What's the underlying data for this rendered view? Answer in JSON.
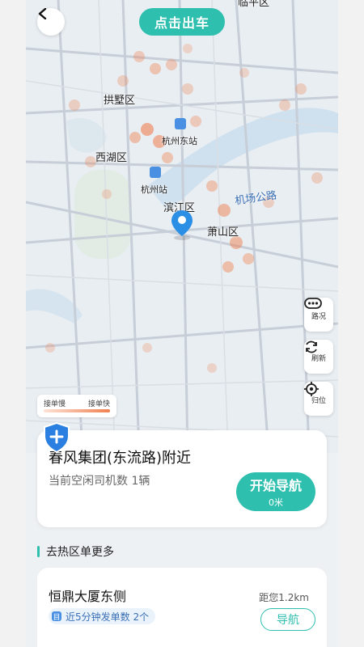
{
  "header": {
    "depart_label": "点击出车"
  },
  "map": {
    "district_labels": [
      "拱墅区",
      "西湖区",
      "滨江区",
      "萧山区",
      "临平区"
    ],
    "station_labels": [
      "杭州东站",
      "杭州站"
    ],
    "road_labels": [
      "机场公路"
    ]
  },
  "controls": {
    "traffic_label": "路况",
    "refresh_label": "刷新",
    "locate_label": "归位"
  },
  "legend": {
    "slow_label": "接单慢",
    "fast_label": "接单快",
    "gradient_start": "#fde3d6",
    "gradient_end": "#f08050"
  },
  "location_card": {
    "title": "春风集团(东流路)附近",
    "idle_drivers": "当前空闲司机数 1辆",
    "nav_button_label": "开始导航",
    "nav_distance": "0米"
  },
  "hot_section": {
    "title": "去热区单更多",
    "items": [
      {
        "name": "恒鼎大厦东侧",
        "distance": "距您1.2km",
        "tag_icon": "目",
        "tag_text": "近5分钟发单数 2个",
        "nav_label": "导航"
      }
    ]
  },
  "colors": {
    "accent": "#2fbfae",
    "heat": "#f08050"
  }
}
